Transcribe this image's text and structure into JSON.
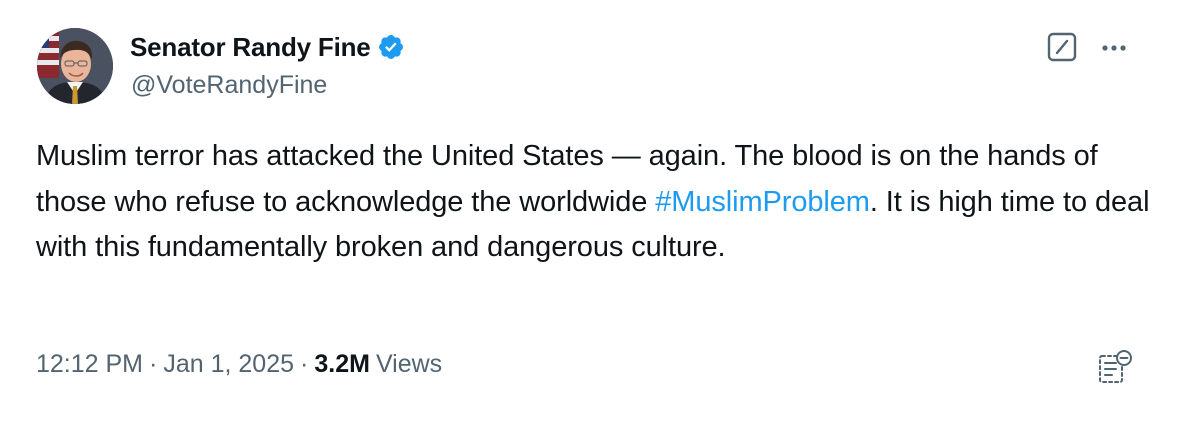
{
  "author": {
    "display_name": "Senator Randy Fine",
    "handle": "@VoteRandyFine",
    "verified": true,
    "verified_color": "#1d9bf0"
  },
  "header_icons": {
    "grok": "grok-icon",
    "more": "more-icon"
  },
  "post": {
    "text_part1": "Muslim terror has attacked the United States — again.   The blood is on the hands of those who refuse to acknowledge the worldwide ",
    "hashtag": "#MuslimProblem",
    "text_part2": ".  It is high time to deal with this fundamentally broken and dangerous culture."
  },
  "meta": {
    "time": "12:12 PM",
    "separator": "·",
    "date": "Jan 1, 2025",
    "views_count": "3.2M",
    "views_label": "Views"
  },
  "footer_icons": {
    "bookmark": "bookmark-list-icon"
  },
  "colors": {
    "text": "#0f1419",
    "secondary": "#536471",
    "link": "#1d9bf0"
  }
}
